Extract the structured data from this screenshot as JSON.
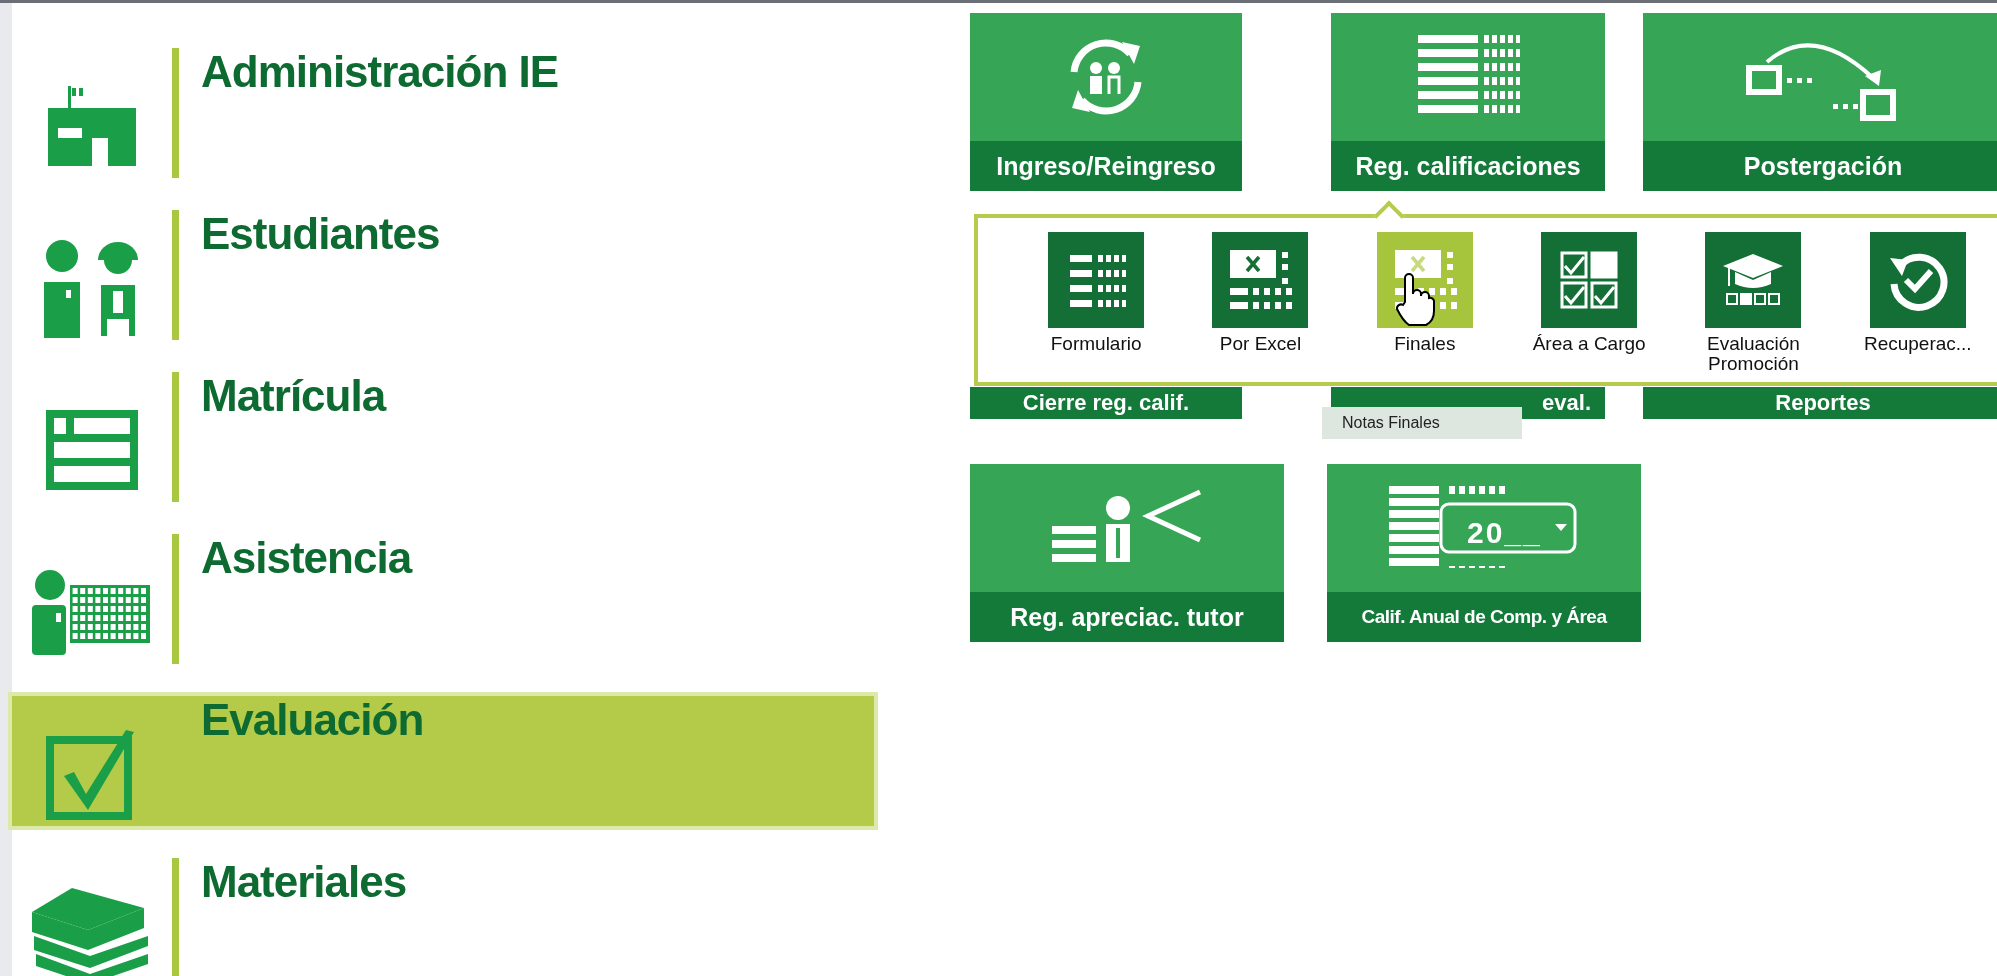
{
  "sidebar": {
    "items": [
      {
        "label": "Administración IE",
        "kind": "school",
        "selected": false
      },
      {
        "label": "Estudiantes",
        "kind": "students",
        "selected": false
      },
      {
        "label": "Matrícula",
        "kind": "enrollment",
        "selected": false
      },
      {
        "label": "Asistencia",
        "kind": "attendance",
        "selected": false
      },
      {
        "label": "Evaluación",
        "kind": "evaluation",
        "selected": true
      },
      {
        "label": "Materiales",
        "kind": "materials",
        "selected": false
      }
    ]
  },
  "tiles": [
    {
      "label": "Ingreso/Reingreso",
      "kind": "reentry"
    },
    {
      "label": "Reg. calificaciones",
      "kind": "grades"
    },
    {
      "label": "Postergación",
      "kind": "postpone"
    }
  ],
  "covered_tiles": [
    {
      "label": "Cierre reg. calif."
    },
    {
      "label": "eval."
    },
    {
      "label": "Reportes"
    }
  ],
  "submenu": {
    "items": [
      {
        "label": "Formulario",
        "kind": "form",
        "selected": false
      },
      {
        "label": "Por Excel",
        "kind": "excel",
        "selected": false
      },
      {
        "label": "Finales",
        "kind": "excel",
        "selected": true
      },
      {
        "label": "Área a Cargo",
        "kind": "checks",
        "selected": false
      },
      {
        "label": "Evaluación Promoción",
        "kind": "promotion",
        "selected": false
      },
      {
        "label": "Recuperac...",
        "kind": "recovery",
        "selected": false
      }
    ]
  },
  "tooltip": "Notas Finales",
  "bottom_tiles": [
    {
      "label": "Reg. apreciac. tutor",
      "kind": "tutor"
    },
    {
      "label": "Calif. Anual de Comp. y Área",
      "kind": "annual",
      "year": "20__"
    }
  ]
}
